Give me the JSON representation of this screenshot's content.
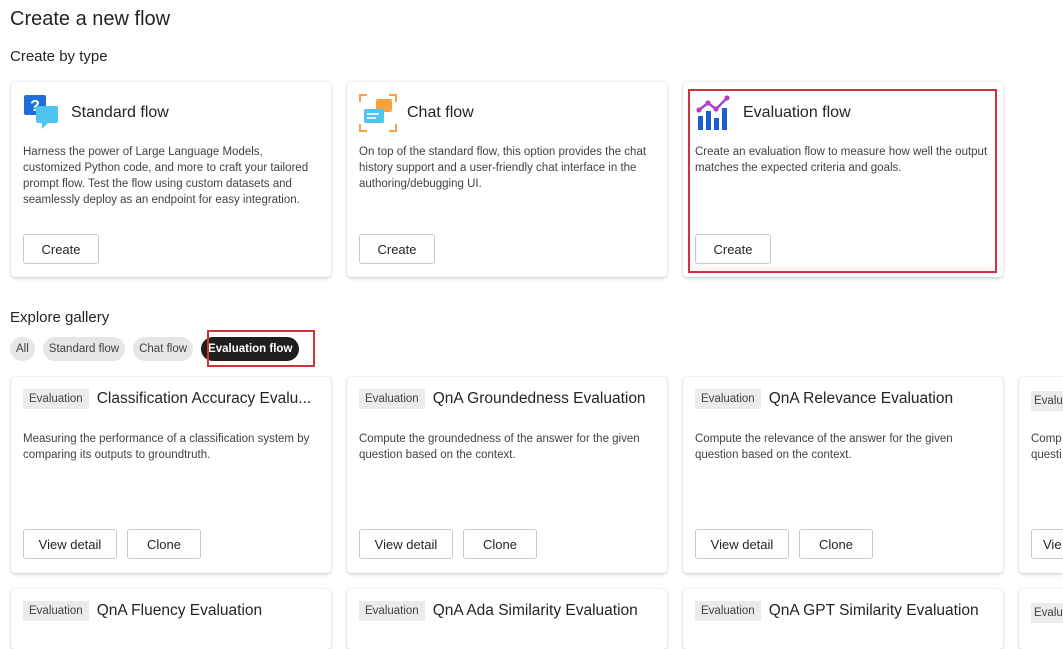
{
  "page": {
    "title": "Create a new flow"
  },
  "create_by_type": {
    "title": "Create by type",
    "cards": [
      {
        "name": "Standard flow",
        "icon": "question-chat-icon",
        "description": "Harness the power of Large Language Models, customized Python code, and more to craft your tailored prompt flow. Test the flow using custom datasets and seamlessly deploy as an endpoint for easy integration.",
        "button": "Create"
      },
      {
        "name": "Chat flow",
        "icon": "chat-window-icon",
        "description": "On top of the standard flow, this option provides the chat history support and a user-friendly chat interface in the authoring/debugging UI.",
        "button": "Create"
      },
      {
        "name": "Evaluation flow",
        "icon": "chart-evaluation-icon",
        "description": "Create an evaluation flow to measure how well the output matches the expected criteria and goals.",
        "button": "Create",
        "highlighted": true
      }
    ]
  },
  "gallery": {
    "title": "Explore gallery",
    "filters": [
      {
        "label": "All",
        "selected": false
      },
      {
        "label": "Standard flow",
        "selected": false
      },
      {
        "label": "Chat flow",
        "selected": false
      },
      {
        "label": "Evaluation flow",
        "selected": true
      }
    ],
    "badge": "Evaluation",
    "view_detail_label": "View detail",
    "clone_label": "Clone",
    "cards": [
      {
        "name": "Classification Accuracy Evalu...",
        "description": "Measuring the performance of a classification system by comparing its outputs to groundtruth."
      },
      {
        "name": "QnA Groundedness Evaluation",
        "description": "Compute the groundedness of the answer for the given question based on the context."
      },
      {
        "name": "QnA Relevance Evaluation",
        "description": "Compute the relevance of the answer for the given question based on the context."
      },
      {
        "name": "",
        "description": "Comp questi",
        "partial_badge": "Evalu",
        "partial_button": "Vie"
      },
      {
        "name": "QnA Fluency Evaluation"
      },
      {
        "name": "QnA Ada Similarity Evaluation"
      },
      {
        "name": "QnA GPT Similarity Evaluation"
      }
    ]
  },
  "colors": {
    "highlight": "#d13438",
    "selected_chip": "#1f1f1f",
    "accent_blue": "#2b88d8"
  }
}
